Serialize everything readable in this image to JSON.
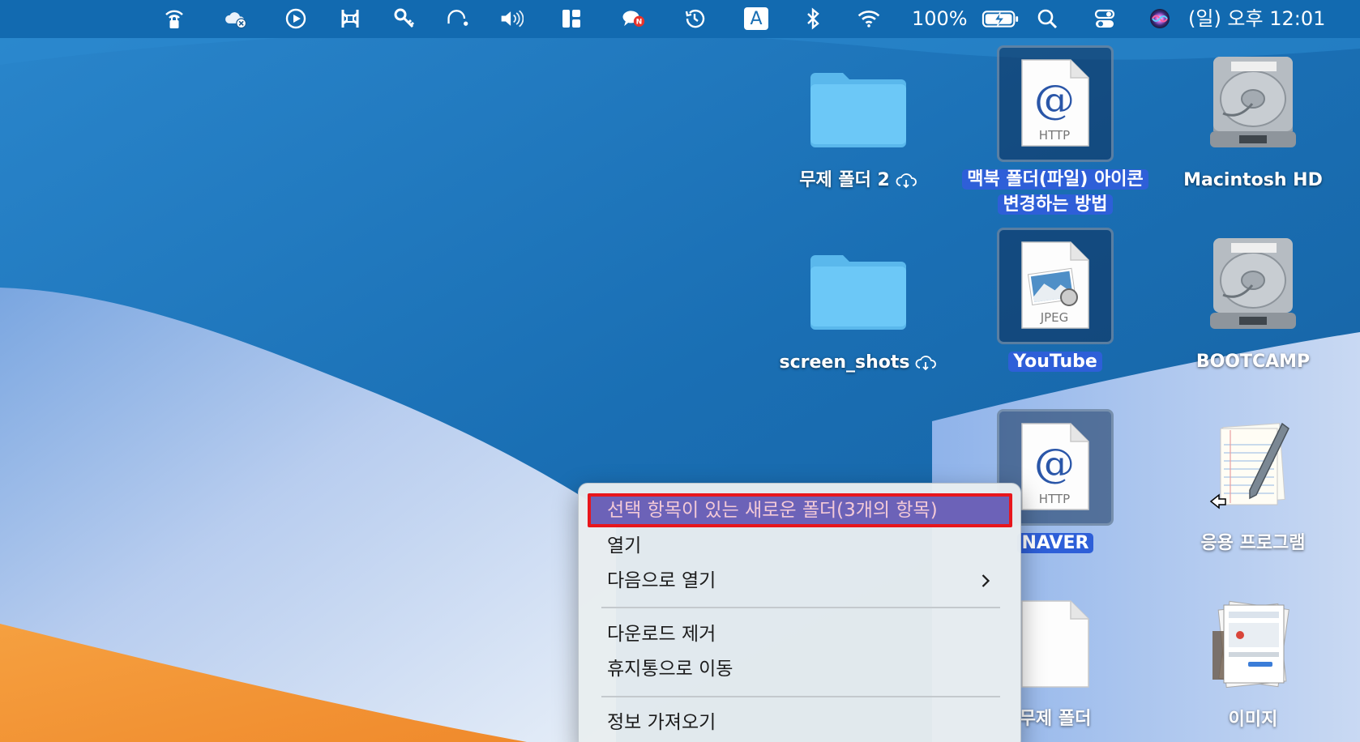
{
  "menubar": {
    "icons": [
      "wifi-lock-icon",
      "cloud-disconnected-icon",
      "play-circle-icon",
      "scissors-icon",
      "key-icon",
      "headphones-icon",
      "volume-icon",
      "layout-icon",
      "notification-chat-icon",
      "time-machine-icon",
      "input-source-icon",
      "bluetooth-icon",
      "wifi-icon",
      "search-icon",
      "control-center-icon",
      "siri-icon"
    ],
    "input_source_letter": "A",
    "battery_percent": "100%",
    "clock": "(일) 오후 12:01"
  },
  "desktop": {
    "items": [
      {
        "label": "무제 폴더 2",
        "icon": "folder-icon",
        "cloud": true,
        "selected": false
      },
      {
        "label": "맥북 폴더(파일) 아이콘 변경하는 방법",
        "icon": "http-document-icon",
        "badge": "HTTP",
        "selected": true
      },
      {
        "label": "Macintosh HD",
        "icon": "hard-drive-icon",
        "selected": false
      },
      {
        "label": "screen_shots",
        "icon": "folder-icon",
        "cloud": true,
        "selected": false
      },
      {
        "label": "YouTube",
        "icon": "jpeg-document-icon",
        "badge": "JPEG",
        "selected": true
      },
      {
        "label": "BOOTCAMP",
        "icon": "hard-drive-icon",
        "selected": false
      },
      {
        "label": "NAVER",
        "icon": "http-document-icon",
        "badge": "HTTP",
        "selected": true
      },
      {
        "label": "응용 프로그램",
        "icon": "applications-alias-icon",
        "selected": false
      },
      {
        "label": "무제 폴더",
        "icon": "blank-document-icon",
        "selected": false
      },
      {
        "label": "이미지",
        "icon": "images-stack-icon",
        "selected": false
      }
    ]
  },
  "context_menu": {
    "items": [
      {
        "label": "선택 항목이 있는 새로운 폴더(3개의 항목)",
        "highlighted": true
      },
      {
        "label": "열기"
      },
      {
        "label": "다음으로 열기",
        "submenu": true
      },
      {
        "label": "다운로드 제거"
      },
      {
        "label": "휴지통으로 이동"
      },
      {
        "label": "정보 가져오기"
      }
    ]
  },
  "colors": {
    "wallpaper_blue": "#1f6fb3",
    "menubar": "#1269af",
    "selection_label": "#2e5fd8",
    "menu_highlight": "#6c62b8",
    "annotation_border": "#e8161c",
    "folder": "#6cc8f7"
  }
}
